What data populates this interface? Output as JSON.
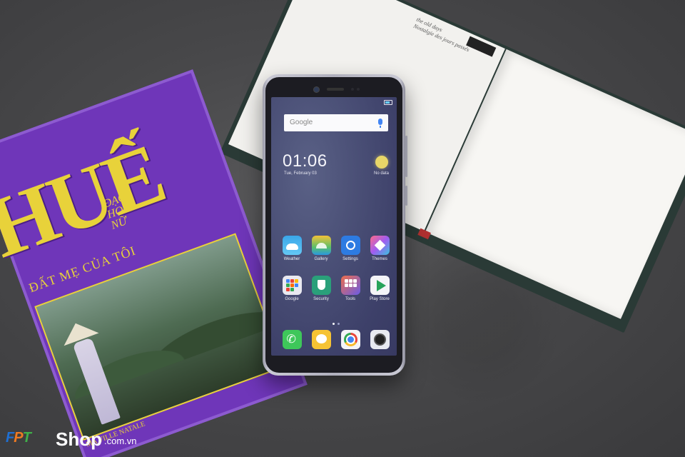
{
  "book_top_right": {
    "text_lines": [
      "the old days",
      "Nostalgie des jours passés"
    ]
  },
  "book_bottom_left": {
    "title": "HUẾ",
    "script_title": [
      "ĐẠO",
      "HOA",
      "NỮ"
    ],
    "subtitle": "ĐẤT MẸ CỦA TÔI",
    "author_line": "MA VILLE NATALE"
  },
  "phone": {
    "search_placeholder": "Google",
    "clock": "01:06",
    "date": "Tue, February 03",
    "weather_status": "No data",
    "apps_row1": [
      {
        "label": "Weather",
        "icon": "weather-icon"
      },
      {
        "label": "Gallery",
        "icon": "gallery-icon"
      },
      {
        "label": "Settings",
        "icon": "settings-icon"
      },
      {
        "label": "Themes",
        "icon": "themes-icon"
      }
    ],
    "apps_row2": [
      {
        "label": "Google",
        "icon": "google-folder-icon"
      },
      {
        "label": "Security",
        "icon": "security-icon"
      },
      {
        "label": "Tools",
        "icon": "tools-folder-icon"
      },
      {
        "label": "Play Store",
        "icon": "play-store-icon"
      }
    ],
    "dock": [
      {
        "icon": "phone-icon"
      },
      {
        "icon": "messaging-icon"
      },
      {
        "icon": "chrome-icon"
      },
      {
        "icon": "camera-icon"
      }
    ]
  },
  "watermark": {
    "brand_f": "F",
    "brand_p": "P",
    "brand_t": "T",
    "shop": "Shop",
    "domain": ".com.vn"
  }
}
